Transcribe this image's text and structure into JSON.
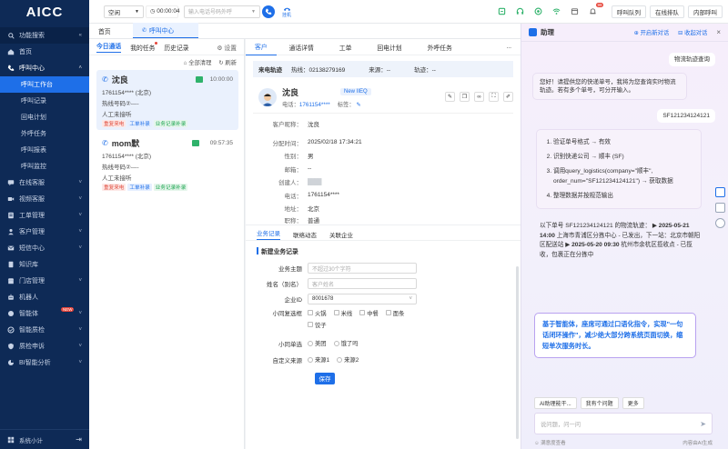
{
  "sidebar": {
    "logo": "AICC",
    "search_label": "功能搜索",
    "home": "首页",
    "call_center": "呼叫中心",
    "call_sub": [
      "呼叫工作台",
      "呼叫记录",
      "回电计划",
      "外呼任务",
      "呼叫报表",
      "呼叫监控"
    ],
    "menu": [
      "在线客服",
      "视频客服",
      "工单管理",
      "客户管理",
      "短信中心",
      "知识库",
      "门店管理",
      "机器人",
      "智能体",
      "智能质检",
      "质检申诉",
      "BI智能分析"
    ],
    "new_badge": "NEW",
    "footer": "系统小计"
  },
  "topbar": {
    "status": "空闲",
    "timer": "00:00:04",
    "phone_placeholder": "输入电话号码外呼",
    "hangup": "挂机",
    "notif_count": "99",
    "queue_btn": "呼叫队列",
    "online_btn": "在线排队",
    "internal_btn": "内部呼叫"
  },
  "tabs": [
    "首页",
    "呼叫中心"
  ],
  "calllist": {
    "tabs": [
      "今日通话",
      "我的任务",
      "历史记录"
    ],
    "settings": "设置",
    "read_all": "全部清理",
    "refresh": "刷新",
    "cards": [
      {
        "name": "沈良",
        "time": "10:00:00",
        "phone": "1761154**** (北京)",
        "line": "热线号码②----",
        "status": "人工未接听",
        "tags": [
          "重复来电",
          "工单补录",
          "业务记录补录"
        ]
      },
      {
        "name": "mom默",
        "time": "09:57:35",
        "phone": "1761154**** (北京)",
        "line": "热线号码②----",
        "status": "人工未接听",
        "tags": [
          "重复来电",
          "工单补录",
          "业务记录补录"
        ]
      }
    ]
  },
  "detail": {
    "tabs": [
      "客户",
      "通话详情",
      "工单",
      "回电计划",
      "外呼任务"
    ],
    "more": "...",
    "info": {
      "label1": "来电轨迹",
      "hot_label": "热线：",
      "hot": "02138279169",
      "src_label": "来源：",
      "src": "--",
      "track_label": "轨迹：",
      "track": "--"
    },
    "customer": {
      "name": "沈良",
      "badge": "New IIEQ",
      "phone_label": "电话：",
      "phone": "1761154****",
      "tag_label": "标签："
    },
    "fields": [
      {
        "k": "客户昵称：",
        "v": "沈良"
      },
      {
        "k": "分配时间：",
        "v": "2025/02/18 17:34:21"
      },
      {
        "k": "性别：",
        "v": "男"
      },
      {
        "k": "邮箱：",
        "v": "--"
      },
      {
        "k": "创建人：",
        "v": "████"
      },
      {
        "k": "电话：",
        "v": "1761154****"
      },
      {
        "k": "地址：",
        "v": "北京"
      },
      {
        "k": "职称：",
        "v": "普通"
      }
    ],
    "subtabs": [
      "业务记录",
      "联络动态",
      "关联企业"
    ],
    "form_title": "新建业务记录",
    "form": {
      "subject_label": "业务主题",
      "subject_ph": "不超过30个字符",
      "name_label": "姓名（别名）",
      "name_ph": "客户姓名",
      "company_label": "企业ID",
      "company_val": "8001678",
      "multi_label": "小同复选框",
      "multi_opts": [
        "火锅",
        "米线",
        "中餐",
        "面条",
        "饺子"
      ],
      "single_label": "小同单选",
      "single_opts": [
        "美团",
        "饿了吗"
      ],
      "custom_label": "自定义来源",
      "custom_opts": [
        "来源1",
        "来源2"
      ],
      "save": "保存"
    }
  },
  "assistant": {
    "title": "助理",
    "new_chat": "开启新对话",
    "collapse": "收起对话",
    "q1": "物流轨迹查询",
    "a1": "您好！请提供您的快递单号，我将为您查询实时物流轨迹。若有多个单号，可分开输入。",
    "q2": "SF121234124121",
    "steps": [
      "验证单号格式 → 有效",
      "识别快递公司 → 顺丰 (SF)",
      "调用query_logistics(company=\"顺丰\", order_num=\"SF121234124121\") → 获取数据",
      "整理数据并按规范输出"
    ],
    "result_intro": "以下单号 SF121234124121 的物流轨迹：",
    "result_1_date": "2025-05-21 14:00",
    "result_1": "上海市青浦区分拣中心 - 已发出，下一站：北京市朝阳区配送站",
    "result_2_date": "2025-05-20 09:30",
    "result_2": "杭州市余杭区揽收点 - 已揽收，包裹正在分拣中",
    "highlight": "基于智能体，座席可通过口语化指令，实现\"一句话闭环操作\"，减少绝大部分跨系统页面切换，缩短单次服务时长。",
    "chips": [
      "AI助理能干...",
      "我有个问题",
      "更多"
    ],
    "input_ph": "说问题，问一问",
    "footer_left": "满意度查看",
    "footer_right": "内容由AI生成"
  },
  "colors": {
    "sidebar": "#0e2a56",
    "accent": "#1e6fe8",
    "highlight_border": "#b9a2f0"
  }
}
